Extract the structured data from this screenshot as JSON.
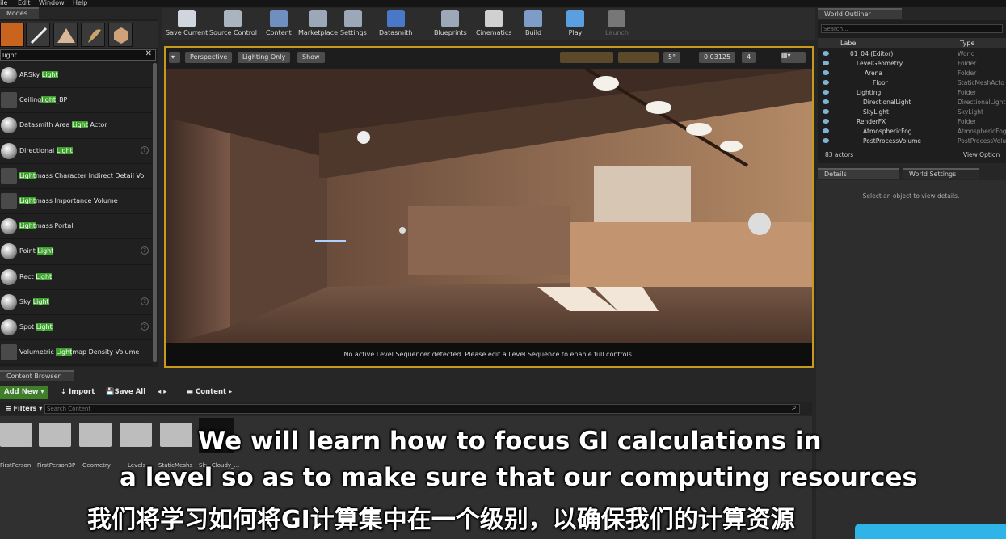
{
  "menu": [
    "ile",
    "Edit",
    "Window",
    "Help"
  ],
  "modes": {
    "tab": "Modes",
    "search_value": "light",
    "items": [
      {
        "pre": "ARSky ",
        "hl": "Light",
        "post": ""
      },
      {
        "pre": "Ceiling",
        "hl": "light",
        "post": "_BP"
      },
      {
        "pre": "Datasmith Area ",
        "hl": "Light",
        "post": " Actor"
      },
      {
        "pre": "Directional ",
        "hl": "Light",
        "post": ""
      },
      {
        "pre": "",
        "hl": "Light",
        "post": "mass Character Indirect Detail Vo"
      },
      {
        "pre": "",
        "hl": "Light",
        "post": "mass Importance Volume"
      },
      {
        "pre": "",
        "hl": "Light",
        "post": "mass Portal"
      },
      {
        "pre": "Point ",
        "hl": "Light",
        "post": ""
      },
      {
        "pre": "Rect ",
        "hl": "Light",
        "post": ""
      },
      {
        "pre": "Sky ",
        "hl": "Light",
        "post": ""
      },
      {
        "pre": "Spot ",
        "hl": "Light",
        "post": ""
      },
      {
        "pre": "Volumetric ",
        "hl": "Light",
        "post": "map Density Volume"
      }
    ]
  },
  "toolbar": {
    "buttons": [
      "Save Current",
      "Source Control",
      "Content",
      "Marketplace",
      "Settings",
      "Datasmith",
      "Blueprints",
      "Cinematics",
      "Build",
      "Play",
      "Launch"
    ]
  },
  "viewport": {
    "perspective": "Perspective",
    "lighting": "Lighting Only",
    "show": "Show",
    "value": "0.03125",
    "angle": "5°",
    "speed": "4",
    "status": "No active Level Sequencer detected. Please edit a Level Sequence to enable full controls."
  },
  "outliner": {
    "tab": "World Outliner",
    "search_placeholder": "Search...",
    "col_label": "Label",
    "col_type": "Type",
    "rows": [
      {
        "name": "01_04 (Editor)",
        "type": "World"
      },
      {
        "name": "LevelGeometry",
        "type": "Folder"
      },
      {
        "name": "Arena",
        "type": "Folder"
      },
      {
        "name": "Floor",
        "type": "StaticMeshActo"
      },
      {
        "name": "Lighting",
        "type": "Folder"
      },
      {
        "name": "DirectionalLight",
        "type": "DirectionalLight"
      },
      {
        "name": "SkyLight",
        "type": "SkyLight"
      },
      {
        "name": "RenderFX",
        "type": "Folder"
      },
      {
        "name": "AtmosphericFog",
        "type": "AtmosphericFog"
      },
      {
        "name": "PostProcessVolume",
        "type": "PostProcessVolu"
      }
    ],
    "count": "83 actors",
    "view_options": "View Option"
  },
  "details": {
    "tab1": "Details",
    "tab2": "World Settings",
    "message": "Select an object to view details."
  },
  "content_browser": {
    "tab": "Content Browser",
    "add_new": "Add New",
    "import": "Import",
    "save_all": "Save All",
    "path": "Content",
    "filters": "Filters",
    "search_placeholder": "Search Content",
    "folders": [
      "FirstPerson",
      "FirstPersonBP",
      "Geometry",
      "Levels",
      "StaticMeshs",
      "Sky_Cloudy_..."
    ]
  },
  "subtitles": {
    "line1": "We will learn how to focus GI calculations in",
    "line2": "a level so as to make sure that our computing resources",
    "line3": "我们将学习如何将GI计算集中在一个级别，以确保我们的计算资源"
  }
}
